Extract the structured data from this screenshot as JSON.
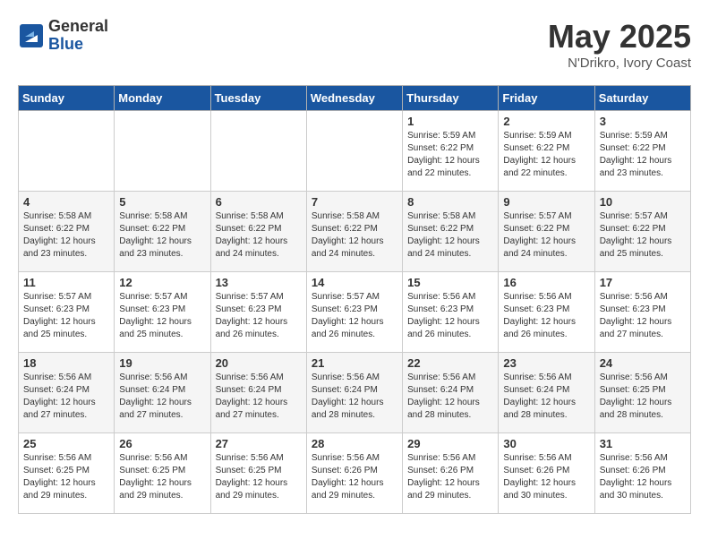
{
  "logo": {
    "general": "General",
    "blue": "Blue"
  },
  "header": {
    "month": "May 2025",
    "location": "N'Drikro, Ivory Coast"
  },
  "weekdays": [
    "Sunday",
    "Monday",
    "Tuesday",
    "Wednesday",
    "Thursday",
    "Friday",
    "Saturday"
  ],
  "weeks": [
    [
      {
        "day": "",
        "info": ""
      },
      {
        "day": "",
        "info": ""
      },
      {
        "day": "",
        "info": ""
      },
      {
        "day": "",
        "info": ""
      },
      {
        "day": "1",
        "info": "Sunrise: 5:59 AM\nSunset: 6:22 PM\nDaylight: 12 hours\nand 22 minutes."
      },
      {
        "day": "2",
        "info": "Sunrise: 5:59 AM\nSunset: 6:22 PM\nDaylight: 12 hours\nand 22 minutes."
      },
      {
        "day": "3",
        "info": "Sunrise: 5:59 AM\nSunset: 6:22 PM\nDaylight: 12 hours\nand 23 minutes."
      }
    ],
    [
      {
        "day": "4",
        "info": "Sunrise: 5:58 AM\nSunset: 6:22 PM\nDaylight: 12 hours\nand 23 minutes."
      },
      {
        "day": "5",
        "info": "Sunrise: 5:58 AM\nSunset: 6:22 PM\nDaylight: 12 hours\nand 23 minutes."
      },
      {
        "day": "6",
        "info": "Sunrise: 5:58 AM\nSunset: 6:22 PM\nDaylight: 12 hours\nand 24 minutes."
      },
      {
        "day": "7",
        "info": "Sunrise: 5:58 AM\nSunset: 6:22 PM\nDaylight: 12 hours\nand 24 minutes."
      },
      {
        "day": "8",
        "info": "Sunrise: 5:58 AM\nSunset: 6:22 PM\nDaylight: 12 hours\nand 24 minutes."
      },
      {
        "day": "9",
        "info": "Sunrise: 5:57 AM\nSunset: 6:22 PM\nDaylight: 12 hours\nand 24 minutes."
      },
      {
        "day": "10",
        "info": "Sunrise: 5:57 AM\nSunset: 6:22 PM\nDaylight: 12 hours\nand 25 minutes."
      }
    ],
    [
      {
        "day": "11",
        "info": "Sunrise: 5:57 AM\nSunset: 6:23 PM\nDaylight: 12 hours\nand 25 minutes."
      },
      {
        "day": "12",
        "info": "Sunrise: 5:57 AM\nSunset: 6:23 PM\nDaylight: 12 hours\nand 25 minutes."
      },
      {
        "day": "13",
        "info": "Sunrise: 5:57 AM\nSunset: 6:23 PM\nDaylight: 12 hours\nand 26 minutes."
      },
      {
        "day": "14",
        "info": "Sunrise: 5:57 AM\nSunset: 6:23 PM\nDaylight: 12 hours\nand 26 minutes."
      },
      {
        "day": "15",
        "info": "Sunrise: 5:56 AM\nSunset: 6:23 PM\nDaylight: 12 hours\nand 26 minutes."
      },
      {
        "day": "16",
        "info": "Sunrise: 5:56 AM\nSunset: 6:23 PM\nDaylight: 12 hours\nand 26 minutes."
      },
      {
        "day": "17",
        "info": "Sunrise: 5:56 AM\nSunset: 6:23 PM\nDaylight: 12 hours\nand 27 minutes."
      }
    ],
    [
      {
        "day": "18",
        "info": "Sunrise: 5:56 AM\nSunset: 6:24 PM\nDaylight: 12 hours\nand 27 minutes."
      },
      {
        "day": "19",
        "info": "Sunrise: 5:56 AM\nSunset: 6:24 PM\nDaylight: 12 hours\nand 27 minutes."
      },
      {
        "day": "20",
        "info": "Sunrise: 5:56 AM\nSunset: 6:24 PM\nDaylight: 12 hours\nand 27 minutes."
      },
      {
        "day": "21",
        "info": "Sunrise: 5:56 AM\nSunset: 6:24 PM\nDaylight: 12 hours\nand 28 minutes."
      },
      {
        "day": "22",
        "info": "Sunrise: 5:56 AM\nSunset: 6:24 PM\nDaylight: 12 hours\nand 28 minutes."
      },
      {
        "day": "23",
        "info": "Sunrise: 5:56 AM\nSunset: 6:24 PM\nDaylight: 12 hours\nand 28 minutes."
      },
      {
        "day": "24",
        "info": "Sunrise: 5:56 AM\nSunset: 6:25 PM\nDaylight: 12 hours\nand 28 minutes."
      }
    ],
    [
      {
        "day": "25",
        "info": "Sunrise: 5:56 AM\nSunset: 6:25 PM\nDaylight: 12 hours\nand 29 minutes."
      },
      {
        "day": "26",
        "info": "Sunrise: 5:56 AM\nSunset: 6:25 PM\nDaylight: 12 hours\nand 29 minutes."
      },
      {
        "day": "27",
        "info": "Sunrise: 5:56 AM\nSunset: 6:25 PM\nDaylight: 12 hours\nand 29 minutes."
      },
      {
        "day": "28",
        "info": "Sunrise: 5:56 AM\nSunset: 6:26 PM\nDaylight: 12 hours\nand 29 minutes."
      },
      {
        "day": "29",
        "info": "Sunrise: 5:56 AM\nSunset: 6:26 PM\nDaylight: 12 hours\nand 29 minutes."
      },
      {
        "day": "30",
        "info": "Sunrise: 5:56 AM\nSunset: 6:26 PM\nDaylight: 12 hours\nand 30 minutes."
      },
      {
        "day": "31",
        "info": "Sunrise: 5:56 AM\nSunset: 6:26 PM\nDaylight: 12 hours\nand 30 minutes."
      }
    ]
  ]
}
